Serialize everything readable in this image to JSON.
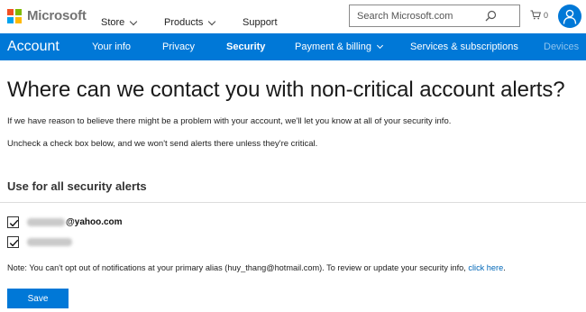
{
  "header": {
    "brand": "Microsoft",
    "nav": [
      {
        "label": "Store"
      },
      {
        "label": "Products"
      },
      {
        "label": "Support"
      }
    ],
    "search": {
      "placeholder": "Search Microsoft.com",
      "value": ""
    },
    "cart_count": "0"
  },
  "account_nav": {
    "title": "Account",
    "items": [
      {
        "label": "Your info"
      },
      {
        "label": "Privacy"
      },
      {
        "label": "Security"
      },
      {
        "label": "Payment & billing"
      },
      {
        "label": "Services & subscriptions"
      },
      {
        "label": "Devices"
      }
    ]
  },
  "content": {
    "heading": "Where can we contact you with non-critical account alerts?",
    "para1": "If we have reason to believe there might be a problem with your account, we'll let you know at all of your security info.",
    "para2": "Uncheck a check box below, and we won't send alerts there unless they're critical.",
    "section_title": "Use for all security alerts",
    "contacts": [
      {
        "visible_text": "@yahoo.com",
        "checked": true
      },
      {
        "visible_text": "",
        "checked": true
      }
    ],
    "note_prefix": "Note: You can't opt out of notifications at your primary alias (huy_thang@hotmail.com). To review or update your security info,",
    "note_link": "click here",
    "note_suffix": ".",
    "save_label": "Save"
  },
  "colors": {
    "accent": "#0078d7",
    "link": "#0067b8",
    "logo_red": "#f25022",
    "logo_green": "#7fba00",
    "logo_blue": "#00a4ef",
    "logo_yellow": "#ffb900"
  }
}
